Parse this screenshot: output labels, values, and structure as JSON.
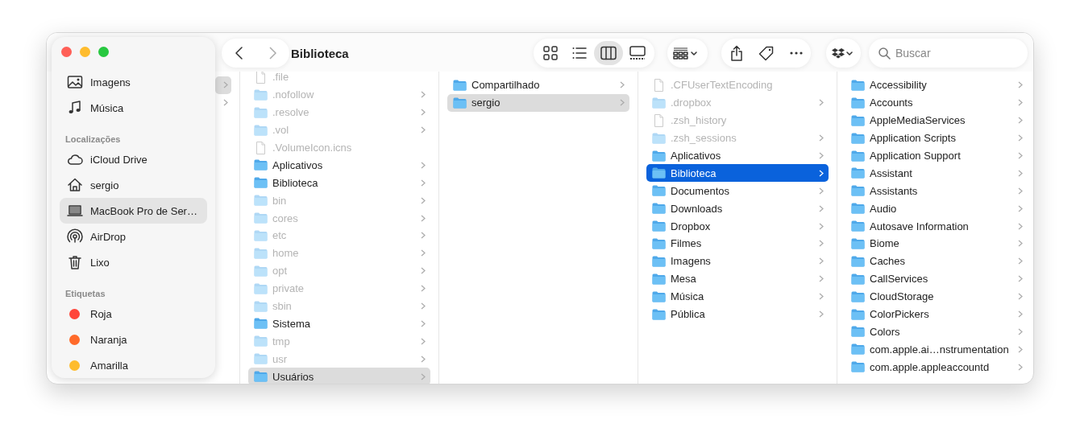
{
  "window": {
    "title": "Biblioteca"
  },
  "toolbar": {
    "view_modes": [
      {
        "selected": false
      },
      {
        "selected": false
      },
      {
        "selected": true
      },
      {
        "selected": false
      }
    ],
    "search": {
      "placeholder": "Buscar"
    }
  },
  "sidebar": {
    "sections": [
      {
        "items": [
          {
            "label": "Imagens",
            "kind": "item",
            "selected": false
          },
          {
            "label": "Música",
            "kind": "item",
            "selected": false
          }
        ]
      },
      {
        "heading": "Localizações",
        "items": [
          {
            "label": "iCloud Drive",
            "kind": "item",
            "selected": false
          },
          {
            "label": "sergio",
            "kind": "item",
            "selected": false
          },
          {
            "label": "MacBook Pro de Ser…",
            "kind": "item",
            "selected": true
          },
          {
            "label": "AirDrop",
            "kind": "item",
            "selected": false
          },
          {
            "label": "Lixo",
            "kind": "item",
            "selected": false
          }
        ]
      },
      {
        "heading": "Etiquetas",
        "items": [
          {
            "label": "Roja",
            "kind": "tag",
            "color": "#ff453a",
            "selected": false
          },
          {
            "label": "Naranja",
            "kind": "tag",
            "color": "#ff6a2a",
            "selected": false
          },
          {
            "label": "Amarilla",
            "kind": "tag",
            "color": "#febc2e",
            "selected": false
          }
        ]
      }
    ]
  },
  "columns": [
    {
      "focused": false,
      "rows": [
        {
          "kind": "folder",
          "selected": true
        },
        {
          "kind": "folder",
          "selected": false
        }
      ]
    },
    {
      "focused": false,
      "rows": [
        {
          "name": ".file",
          "kind": "file",
          "selected": false,
          "dimmed": true
        },
        {
          "name": ".nofollow",
          "kind": "folder",
          "selected": false,
          "dimmed": true
        },
        {
          "name": ".resolve",
          "kind": "folder",
          "selected": false,
          "dimmed": true
        },
        {
          "name": ".vol",
          "kind": "folder",
          "selected": false,
          "dimmed": true
        },
        {
          "name": ".VolumeIcon.icns",
          "kind": "file",
          "selected": false,
          "dimmed": true
        },
        {
          "name": "Aplicativos",
          "kind": "folder",
          "selected": false,
          "dimmed": false
        },
        {
          "name": "Biblioteca",
          "kind": "folder",
          "selected": false,
          "dimmed": false
        },
        {
          "name": "bin",
          "kind": "folder",
          "selected": false,
          "dimmed": true
        },
        {
          "name": "cores",
          "kind": "folder",
          "selected": false,
          "dimmed": true
        },
        {
          "name": "etc",
          "kind": "folder",
          "selected": false,
          "dimmed": true
        },
        {
          "name": "home",
          "kind": "folder",
          "selected": false,
          "dimmed": true
        },
        {
          "name": "opt",
          "kind": "folder",
          "selected": false,
          "dimmed": true
        },
        {
          "name": "private",
          "kind": "folder",
          "selected": false,
          "dimmed": true
        },
        {
          "name": "sbin",
          "kind": "folder",
          "selected": false,
          "dimmed": true
        },
        {
          "name": "Sistema",
          "kind": "folder",
          "selected": false,
          "dimmed": false
        },
        {
          "name": "tmp",
          "kind": "folder",
          "selected": false,
          "dimmed": true
        },
        {
          "name": "usr",
          "kind": "folder",
          "selected": false,
          "dimmed": true
        },
        {
          "name": "Usuários",
          "kind": "folder",
          "selected": true,
          "dimmed": false
        }
      ]
    },
    {
      "focused": false,
      "rows": [
        {
          "name": "Compartilhado",
          "kind": "folder",
          "selected": false,
          "dimmed": false
        },
        {
          "name": "sergio",
          "kind": "folder",
          "selected": true,
          "dimmed": false
        }
      ]
    },
    {
      "focused": true,
      "rows": [
        {
          "name": ".CFUserTextEncoding",
          "kind": "file",
          "selected": false,
          "dimmed": true
        },
        {
          "name": ".dropbox",
          "kind": "folder",
          "selected": false,
          "dimmed": true
        },
        {
          "name": ".zsh_history",
          "kind": "file",
          "selected": false,
          "dimmed": true
        },
        {
          "name": ".zsh_sessions",
          "kind": "folder",
          "selected": false,
          "dimmed": true
        },
        {
          "name": "Aplicativos",
          "kind": "folder",
          "selected": false,
          "dimmed": false
        },
        {
          "name": "Biblioteca",
          "kind": "folder",
          "selected": true,
          "dimmed": false
        },
        {
          "name": "Documentos",
          "kind": "folder",
          "selected": false,
          "dimmed": false
        },
        {
          "name": "Downloads",
          "kind": "folder",
          "selected": false,
          "dimmed": false
        },
        {
          "name": "Dropbox",
          "kind": "folder",
          "selected": false,
          "dimmed": false
        },
        {
          "name": "Filmes",
          "kind": "folder",
          "selected": false,
          "dimmed": false
        },
        {
          "name": "Imagens",
          "kind": "folder",
          "selected": false,
          "dimmed": false
        },
        {
          "name": "Mesa",
          "kind": "folder",
          "selected": false,
          "dimmed": false
        },
        {
          "name": "Música",
          "kind": "folder",
          "selected": false,
          "dimmed": false
        },
        {
          "name": "Pública",
          "kind": "folder",
          "selected": false,
          "dimmed": false
        }
      ]
    },
    {
      "rows": [
        {
          "name": "Accessibility",
          "kind": "folder",
          "selected": false,
          "dimmed": false
        },
        {
          "name": "Accounts",
          "kind": "folder",
          "selected": false,
          "dimmed": false
        },
        {
          "name": "AppleMediaServices",
          "kind": "folder",
          "selected": false,
          "dimmed": false
        },
        {
          "name": "Application Scripts",
          "kind": "folder",
          "selected": false,
          "dimmed": false
        },
        {
          "name": "Application Support",
          "kind": "folder",
          "selected": false,
          "dimmed": false
        },
        {
          "name": "Assistant",
          "kind": "folder",
          "selected": false,
          "dimmed": false
        },
        {
          "name": "Assistants",
          "kind": "folder",
          "selected": false,
          "dimmed": false
        },
        {
          "name": "Audio",
          "kind": "folder",
          "selected": false,
          "dimmed": false
        },
        {
          "name": "Autosave Information",
          "kind": "folder",
          "selected": false,
          "dimmed": false
        },
        {
          "name": "Biome",
          "kind": "folder",
          "selected": false,
          "dimmed": false
        },
        {
          "name": "Caches",
          "kind": "folder",
          "selected": false,
          "dimmed": false
        },
        {
          "name": "CallServices",
          "kind": "folder",
          "selected": false,
          "dimmed": false
        },
        {
          "name": "CloudStorage",
          "kind": "folder",
          "selected": false,
          "dimmed": false
        },
        {
          "name": "ColorPickers",
          "kind": "folder",
          "selected": false,
          "dimmed": false
        },
        {
          "name": "Colors",
          "kind": "folder",
          "selected": false,
          "dimmed": false
        },
        {
          "name": "com.apple.ai…nstrumentation",
          "kind": "folder",
          "selected": false,
          "dimmed": false
        },
        {
          "name": "com.apple.appleaccountd",
          "kind": "folder",
          "selected": false,
          "dimmed": false
        }
      ]
    }
  ]
}
